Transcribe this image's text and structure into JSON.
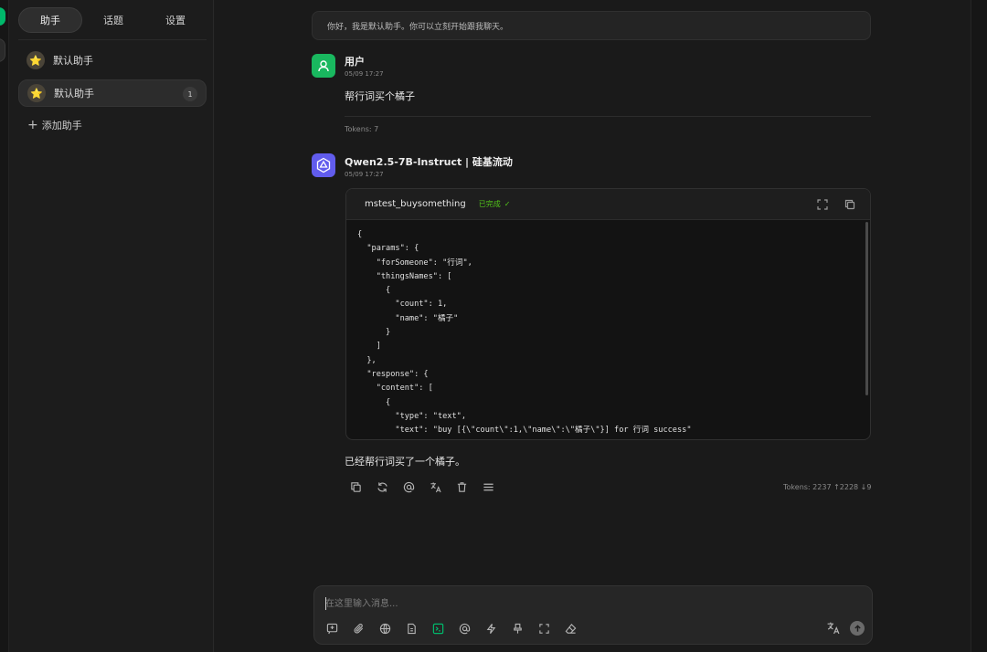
{
  "sidebar": {
    "tabs": [
      {
        "label": "助手"
      },
      {
        "label": "话题"
      },
      {
        "label": "设置"
      }
    ],
    "assistants": [
      {
        "name": "默认助手",
        "icon": "⭐"
      },
      {
        "name": "默认助手",
        "icon": "⭐",
        "count": "1"
      }
    ],
    "add_label": "添加助手"
  },
  "chat": {
    "welcome": "你好，我是默认助手。你可以立刻开始跟我聊天。",
    "user_message": {
      "name": "用户",
      "time": "05/09 17:27",
      "text": "帮行词买个橘子",
      "tokens": "Tokens: 7"
    },
    "bot_message": {
      "name": "Qwen2.5-7B-Instruct | 硅基流动",
      "time": "05/09 17:27",
      "tool": {
        "name": "mstest_buysomething",
        "status": "已完成",
        "code": "{\n  \"params\": {\n    \"forSomeone\": \"行词\",\n    \"thingsNames\": [\n      {\n        \"count\": 1,\n        \"name\": \"橘子\"\n      }\n    ]\n  },\n  \"response\": {\n    \"content\": [\n      {\n        \"type\": \"text\",\n        \"text\": \"buy [{\\\"count\\\":1,\\\"name\\\":\\\"橘子\\\"}] for 行词 success\"\n      }"
      },
      "text": "已经帮行词买了一个橘子。",
      "tokens": "Tokens: 2237 ↑2228 ↓9"
    }
  },
  "input": {
    "placeholder": "在这里输入消息..."
  },
  "colors": {
    "accent": "#00b96b",
    "bot_avatar": "#615ced",
    "status_done": "#52c41a"
  }
}
